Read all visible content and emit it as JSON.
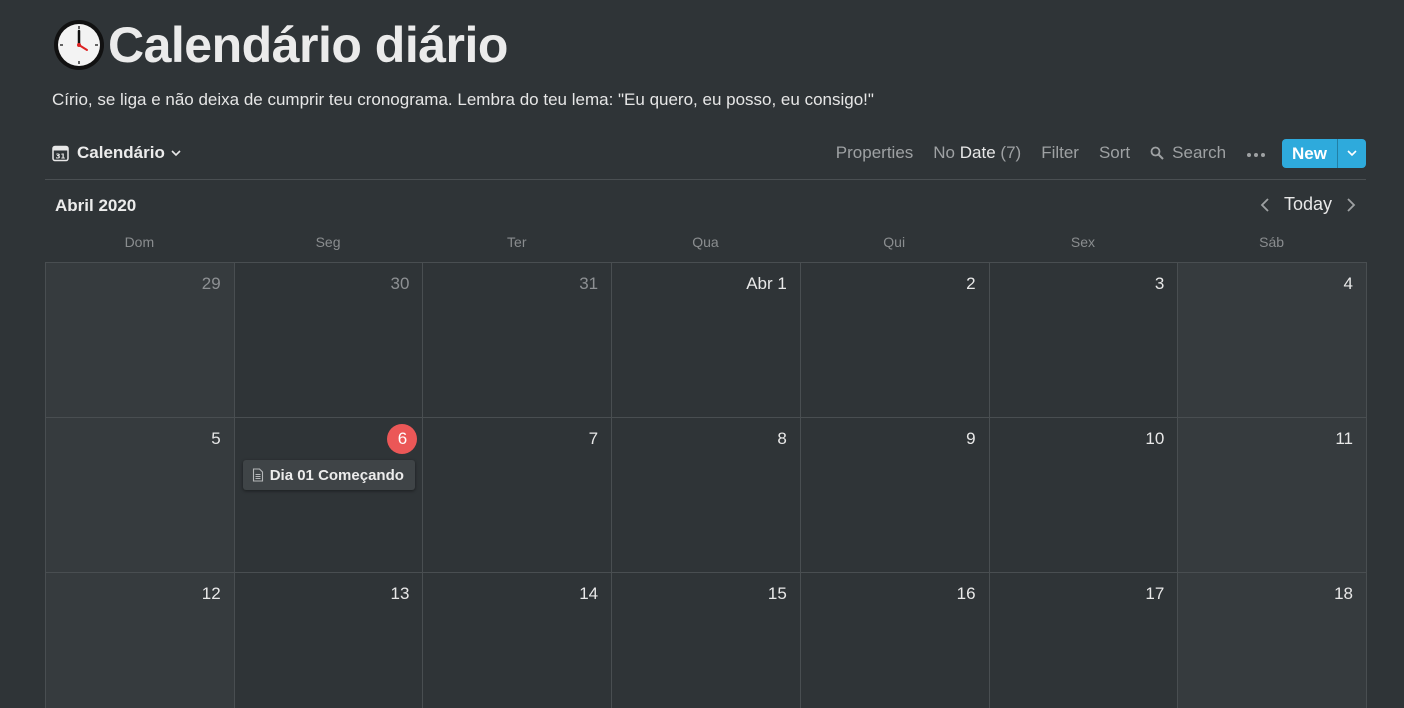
{
  "page": {
    "icon": "clock-icon",
    "title": "Calendário diário",
    "description": "Círio, se liga e não deixa de cumprir teu cronograma. Lembra do teu lema: \"Eu quero, eu posso, eu consigo!\""
  },
  "toolbar": {
    "view_label": "Calendário",
    "view_icon": "calendar-icon",
    "properties": "Properties",
    "no_date_prefix": "No",
    "no_date_word": "Date",
    "no_date_count": "(7)",
    "filter": "Filter",
    "sort": "Sort",
    "search": "Search",
    "new_label": "New"
  },
  "calendar": {
    "month_label": "Abril 2020",
    "today_label": "Today",
    "weekdays": [
      "Dom",
      "Seg",
      "Ter",
      "Qua",
      "Qui",
      "Sex",
      "Sáb"
    ],
    "weeks": [
      [
        "29",
        "30",
        "31",
        "Abr 1",
        "2",
        "3",
        "4"
      ],
      [
        "5",
        "6",
        "7",
        "8",
        "9",
        "10",
        "11"
      ],
      [
        "12",
        "13",
        "14",
        "15",
        "16",
        "17",
        "18"
      ]
    ],
    "event": {
      "title": "Dia 01 Começando",
      "icon": "page-icon"
    }
  },
  "colors": {
    "background": "#2f3437",
    "accent": "#2eaadc",
    "today": "#eb5757"
  }
}
